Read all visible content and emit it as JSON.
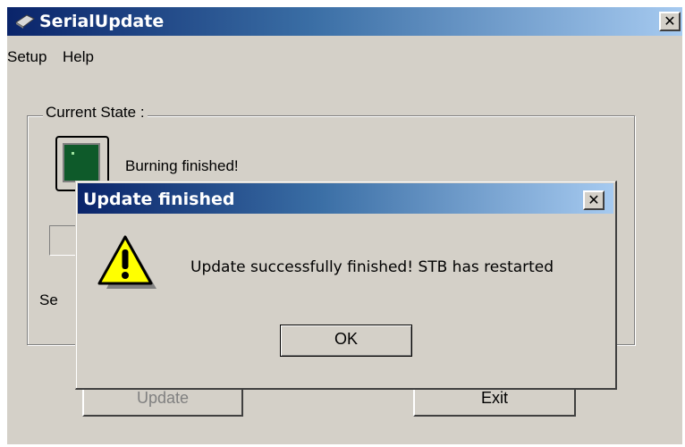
{
  "window": {
    "title": "SerialUpdate",
    "close_glyph": "✕"
  },
  "menu": {
    "items": [
      "Setup",
      "Help"
    ]
  },
  "group": {
    "label": "Current State :",
    "state_text": "Burning finished!",
    "status_label": "Se"
  },
  "buttons": {
    "update_label": "Update",
    "exit_label": "Exit",
    "update_enabled": false
  },
  "dialog": {
    "title": "Update finished",
    "close_glyph": "✕",
    "message": "Update successfully finished! STB has restarted",
    "ok_label": "OK",
    "icon": "warning-icon"
  },
  "colors": {
    "titlebar_start": "#0a246a",
    "titlebar_end": "#a6caf0",
    "face": "#d4d0c8",
    "warning_yellow": "#ffff00"
  }
}
